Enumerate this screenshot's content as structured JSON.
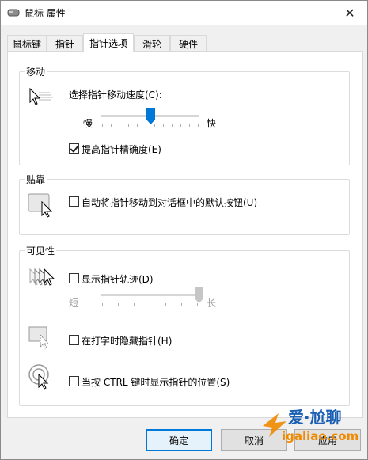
{
  "window": {
    "title": "鼠标 属性",
    "close_glyph": "✕"
  },
  "tabs": [
    {
      "label": "鼠标键"
    },
    {
      "label": "指针"
    },
    {
      "label": "指针选项",
      "active": true
    },
    {
      "label": "滑轮"
    },
    {
      "label": "硬件"
    }
  ],
  "motion": {
    "title": "移动",
    "speed_label": "选择指针移动速度(C):",
    "slow_label": "慢",
    "fast_label": "快",
    "speed_level": 0.5,
    "precision_label": "提高指针精确度(E)",
    "precision_checked": true
  },
  "snap": {
    "title": "贴靠",
    "snap_label": "自动将指针移动到对话框中的默认按钮(U)",
    "snap_checked": false
  },
  "visibility": {
    "title": "可见性",
    "trails_label": "显示指针轨迹(D)",
    "trails_checked": false,
    "short_label": "短",
    "long_label": "长",
    "trail_level": 1.0,
    "hide_label": "在打字时隐藏指针(H)",
    "hide_checked": false,
    "ctrl_label": "当按 CTRL 键时显示指针的位置(S)",
    "ctrl_checked": false
  },
  "buttons": {
    "ok": "确定",
    "cancel": "取消",
    "apply": "应用"
  },
  "watermark": {
    "text": "爱·尬聊",
    "site": "igaliao.com"
  },
  "colors": {
    "accent": "#0078d7",
    "watermark_blue": "#1a5fb4",
    "watermark_orange": "#f08a00"
  }
}
